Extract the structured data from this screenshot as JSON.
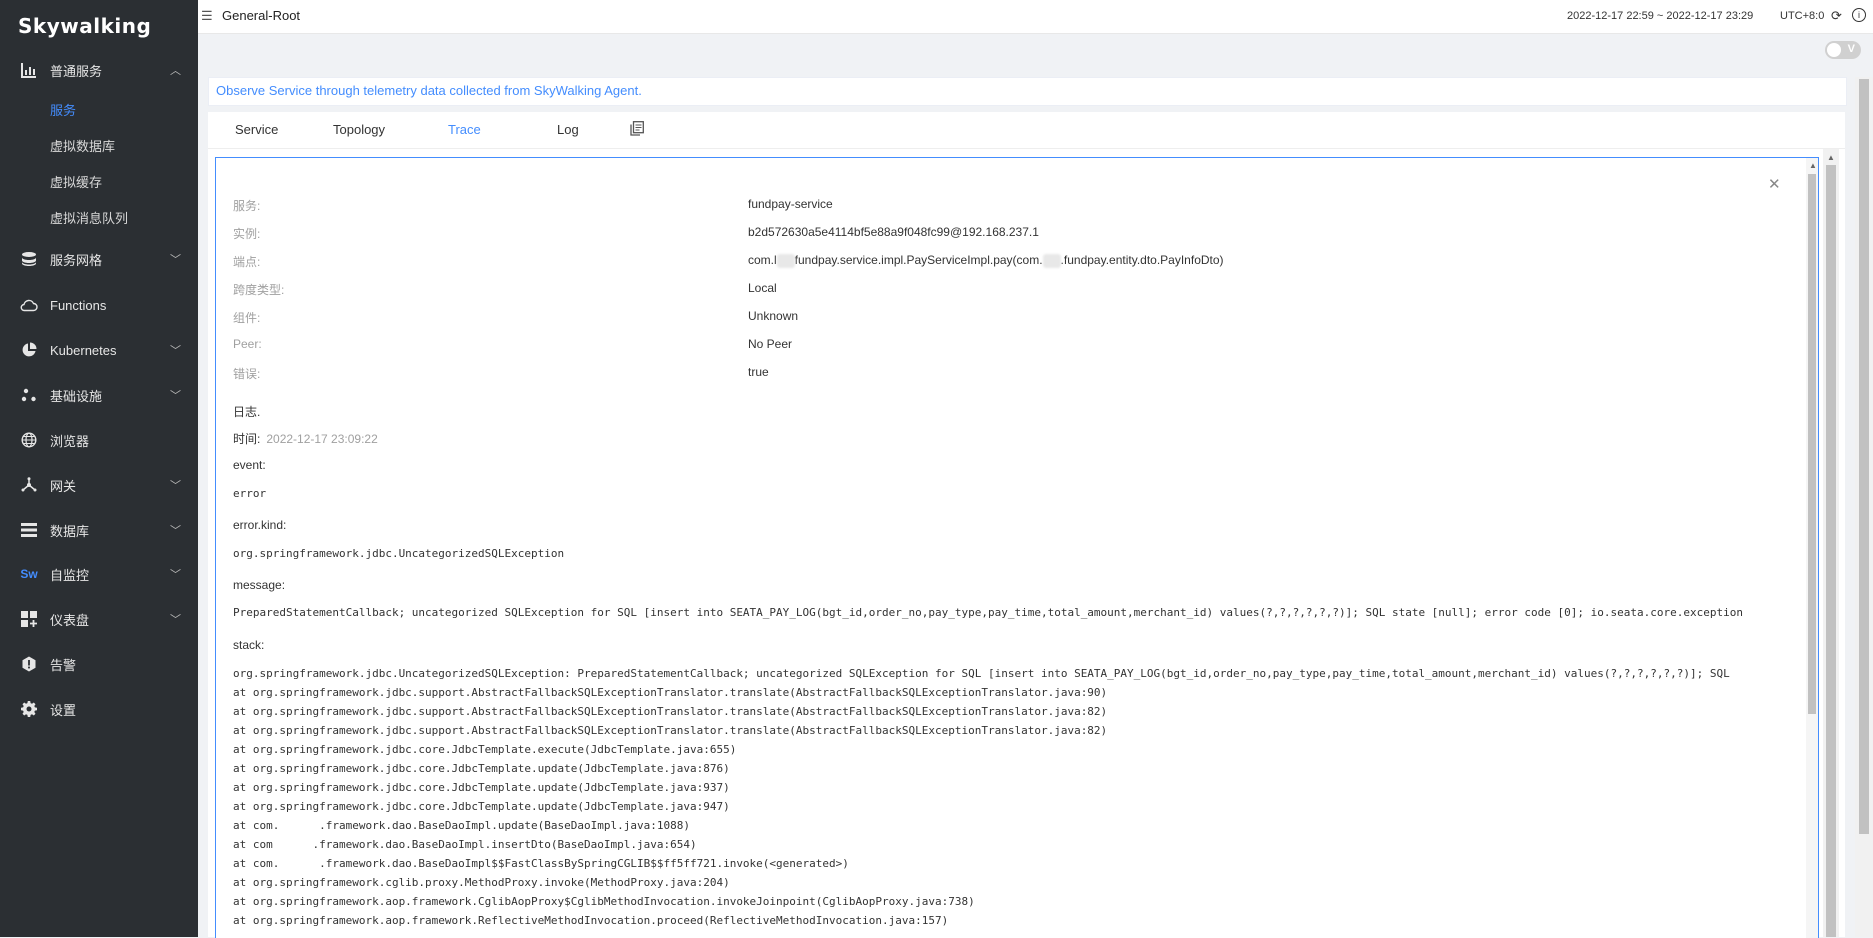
{
  "logo": "Skywalking",
  "sidebar": {
    "groups": [
      {
        "label": "普通服务",
        "icon": "bar-chart-icon",
        "expanded": true
      },
      {
        "label": "服务网格",
        "icon": "database-stack-icon"
      },
      {
        "label": "Functions",
        "icon": "cloud-icon"
      },
      {
        "label": "Kubernetes",
        "icon": "pie-chart-icon"
      },
      {
        "label": "基础设施",
        "icon": "nodes-icon"
      },
      {
        "label": "浏览器",
        "icon": "globe-icon"
      },
      {
        "label": "网关",
        "icon": "gateway-icon"
      },
      {
        "label": "数据库",
        "icon": "list-icon"
      },
      {
        "label": "自监控",
        "icon": "sw-icon"
      },
      {
        "label": "仪表盘",
        "icon": "dashboard-icon"
      },
      {
        "label": "告警",
        "icon": "alert-icon"
      },
      {
        "label": "设置",
        "icon": "gear-icon"
      }
    ],
    "sub_items": [
      "服务",
      "虚拟数据库",
      "虚拟缓存",
      "虚拟消息队列"
    ]
  },
  "topbar": {
    "title": "General-Root",
    "time_range": "2022-12-17 22:59 ~ 2022-12-17 23:29",
    "timezone": "UTC+8:0",
    "toggle_label": "V"
  },
  "notice": "Observe Service through telemetry data collected from SkyWalking Agent.",
  "tabs": [
    "Service",
    "Topology",
    "Trace",
    "Log"
  ],
  "active_tab": "Trace",
  "span": {
    "fields": [
      {
        "key": "服务:",
        "value": "fundpay-service"
      },
      {
        "key": "实例:",
        "value": "b2d572630a5e4114bf5e88a9f048fc99@192.168.237.1"
      },
      {
        "key": "端点:",
        "value_parts": [
          "com.l",
          "fundpay.service.impl.PayServiceImpl.pay(com.",
          ".fundpay.entity.dto.PayInfoDto)"
        ]
      },
      {
        "key": "跨度类型:",
        "value": "Local"
      },
      {
        "key": "组件:",
        "value": "Unknown"
      },
      {
        "key": "Peer:",
        "value": "No Peer"
      },
      {
        "key": "错误:",
        "value": "true"
      }
    ],
    "log_title": "日志.",
    "time_label": "时间:",
    "time_value": "2022-12-17 23:09:22",
    "event_label": "event:",
    "event_value": "error",
    "kind_label": "error.kind:",
    "kind_value": "org.springframework.jdbc.UncategorizedSQLException",
    "message_label": "message:",
    "message_value": "PreparedStatementCallback; uncategorized SQLException for SQL [insert into SEATA_PAY_LOG(bgt_id,order_no,pay_type,pay_time,total_amount,merchant_id) values(?,?,?,?,?,?)]; SQL state [null]; error code [0]; io.seata.core.exception",
    "stack_label": "stack:",
    "stack": [
      "org.springframework.jdbc.UncategorizedSQLException: PreparedStatementCallback; uncategorized SQLException for SQL [insert into SEATA_PAY_LOG(bgt_id,order_no,pay_type,pay_time,total_amount,merchant_id) values(?,?,?,?,?,?)]; SQL",
      "at org.springframework.jdbc.support.AbstractFallbackSQLExceptionTranslator.translate(AbstractFallbackSQLExceptionTranslator.java:90)",
      "at org.springframework.jdbc.support.AbstractFallbackSQLExceptionTranslator.translate(AbstractFallbackSQLExceptionTranslator.java:82)",
      "at org.springframework.jdbc.support.AbstractFallbackSQLExceptionTranslator.translate(AbstractFallbackSQLExceptionTranslator.java:82)",
      "at org.springframework.jdbc.core.JdbcTemplate.execute(JdbcTemplate.java:655)",
      "at org.springframework.jdbc.core.JdbcTemplate.update(JdbcTemplate.java:876)",
      "at org.springframework.jdbc.core.JdbcTemplate.update(JdbcTemplate.java:937)",
      "at org.springframework.jdbc.core.JdbcTemplate.update(JdbcTemplate.java:947)",
      "at com.      .framework.dao.BaseDaoImpl.update(BaseDaoImpl.java:1088)",
      "at com      .framework.dao.BaseDaoImpl.insertDto(BaseDaoImpl.java:654)",
      "at com.      .framework.dao.BaseDaoImpl$$FastClassBySpringCGLIB$$ff5ff721.invoke(<generated>)",
      "at org.springframework.cglib.proxy.MethodProxy.invoke(MethodProxy.java:204)",
      "at org.springframework.aop.framework.CglibAopProxy$CglibMethodInvocation.invokeJoinpoint(CglibAopProxy.java:738)",
      "at org.springframework.aop.framework.ReflectiveMethodInvocation.proceed(ReflectiveMethodInvocation.java:157)"
    ]
  }
}
